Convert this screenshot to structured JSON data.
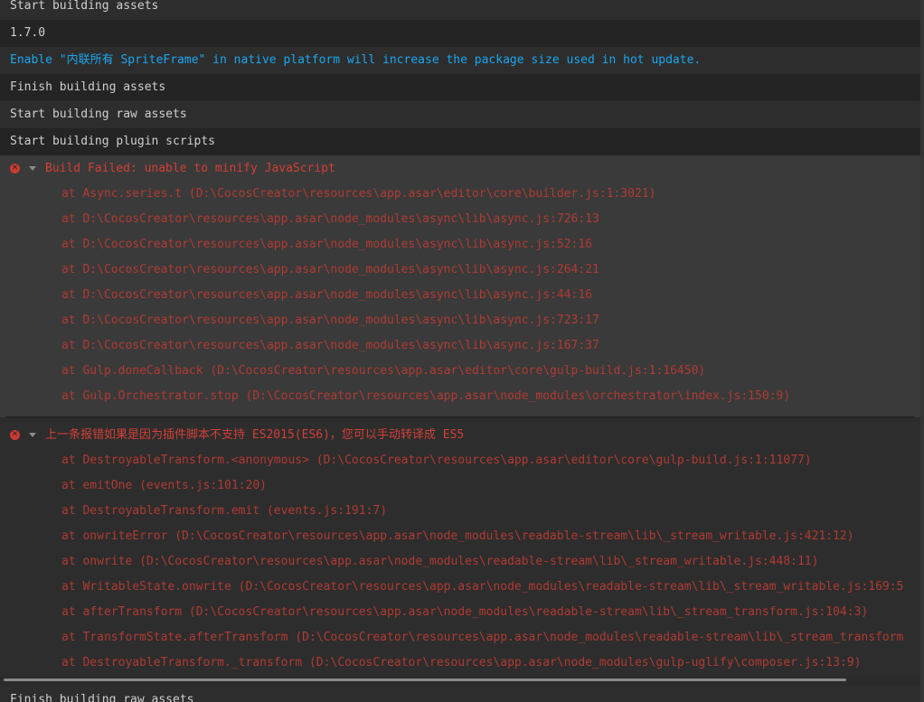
{
  "logs": {
    "row0": "Start building assets",
    "row1": "1.7.0",
    "row2": "Enable \"内联所有 SpriteFrame\" in native platform will increase the package size used in hot update.",
    "row3": "Finish building assets",
    "row4": "Start building raw assets",
    "row5": "Start building plugin scripts"
  },
  "error1": {
    "title": "Build Failed: unable to minify JavaScript",
    "stack": [
      "at Async.series.t (D:\\CocosCreator\\resources\\app.asar\\editor\\core\\builder.js:1:3021)",
      "at D:\\CocosCreator\\resources\\app.asar\\node_modules\\async\\lib\\async.js:726:13",
      "at D:\\CocosCreator\\resources\\app.asar\\node_modules\\async\\lib\\async.js:52:16",
      "at D:\\CocosCreator\\resources\\app.asar\\node_modules\\async\\lib\\async.js:264:21",
      "at D:\\CocosCreator\\resources\\app.asar\\node_modules\\async\\lib\\async.js:44:16",
      "at D:\\CocosCreator\\resources\\app.asar\\node_modules\\async\\lib\\async.js:723:17",
      "at D:\\CocosCreator\\resources\\app.asar\\node_modules\\async\\lib\\async.js:167:37",
      "at Gulp.doneCallback (D:\\CocosCreator\\resources\\app.asar\\editor\\core\\gulp-build.js:1:16450)",
      "at Gulp.Orchestrator.stop (D:\\CocosCreator\\resources\\app.asar\\node_modules\\orchestrator\\index.js:150:9)"
    ]
  },
  "error2": {
    "title": "上一条报错如果是因为插件脚本不支持 ES2015(ES6)，您可以手动转译成 ES5",
    "stack": [
      "at DestroyableTransform.<anonymous> (D:\\CocosCreator\\resources\\app.asar\\editor\\core\\gulp-build.js:1:11077)",
      "at emitOne  (events.js:101:20)",
      "at DestroyableTransform.emit  (events.js:191:7)",
      "at onwriteError (D:\\CocosCreator\\resources\\app.asar\\node_modules\\readable-stream\\lib\\_stream_writable.js:421:12)",
      "at onwrite (D:\\CocosCreator\\resources\\app.asar\\node_modules\\readable-stream\\lib\\_stream_writable.js:448:11)",
      "at WritableState.onwrite (D:\\CocosCreator\\resources\\app.asar\\node_modules\\readable-stream\\lib\\_stream_writable.js:169:5",
      "at afterTransform (D:\\CocosCreator\\resources\\app.asar\\node_modules\\readable-stream\\lib\\_stream_transform.js:104:3)",
      "at TransformState.afterTransform (D:\\CocosCreator\\resources\\app.asar\\node_modules\\readable-stream\\lib\\_stream_transform",
      "at DestroyableTransform._transform (D:\\CocosCreator\\resources\\app.asar\\node_modules\\gulp-uglify\\composer.js:13:9)"
    ]
  },
  "last_row": "Finish building raw assets",
  "colors": {
    "info": "#1ba7f0",
    "error": "#d23f37",
    "text": "#cfcfcf",
    "background": "#2b2b2b"
  },
  "icons": {
    "error": "error-circle-icon",
    "expand": "chevron-down-icon"
  }
}
